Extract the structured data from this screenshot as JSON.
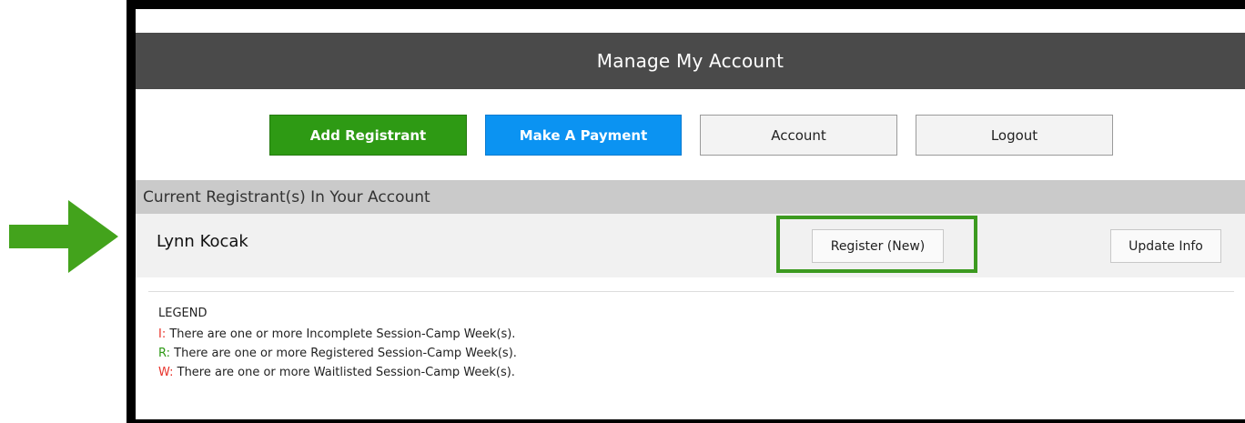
{
  "header": {
    "title": "Manage My Account"
  },
  "actions": {
    "add_registrant": "Add Registrant",
    "make_payment": "Make A Payment",
    "account": "Account",
    "logout": "Logout"
  },
  "section": {
    "title": "Current Registrant(s) In Your Account"
  },
  "registrant": {
    "name": "Lynn Kocak",
    "register_label": "Register (New)",
    "update_label": "Update Info"
  },
  "legend": {
    "title": "LEGEND",
    "items": [
      {
        "code": "I:",
        "text": "There are one or more Incomplete Session-Camp Week(s).",
        "color": "#e8332b"
      },
      {
        "code": "R:",
        "text": "There are one or more Registered Session-Camp Week(s).",
        "color": "#2f9a17"
      },
      {
        "code": "W:",
        "text": "There are one or more Waitlisted Session-Camp Week(s).",
        "color": "#e8332b"
      }
    ]
  },
  "colors": {
    "header_bg": "#4a4a4a",
    "add_button": "#2e9a14",
    "payment_button": "#0b93f2",
    "highlight": "#3c9a20",
    "arrow": "#43a31c"
  }
}
